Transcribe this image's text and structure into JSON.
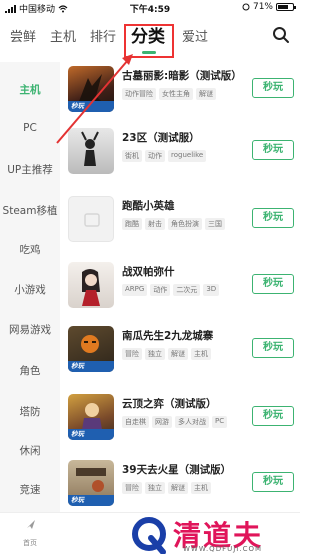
{
  "status_bar": {
    "carrier": "中国移动",
    "time": "下午4:59",
    "battery_text": "71%",
    "battery_level": 0.71
  },
  "top_tabs": [
    {
      "label": "尝鲜"
    },
    {
      "label": "主机"
    },
    {
      "label": "排行"
    },
    {
      "label": "分类"
    },
    {
      "label": "爱过"
    }
  ],
  "active_tab": "分类",
  "sidebar": {
    "items": [
      {
        "label": "主机"
      },
      {
        "label": "PC"
      },
      {
        "label": "UP主推荐"
      },
      {
        "label": "Steam移植"
      },
      {
        "label": "吃鸡"
      },
      {
        "label": "小游戏"
      },
      {
        "label": "网易游戏"
      },
      {
        "label": "角色"
      },
      {
        "label": "塔防"
      },
      {
        "label": "休闲"
      },
      {
        "label": "竞速"
      }
    ],
    "active": "主机"
  },
  "games": [
    {
      "title": "古墓丽影:暗影（测试版）",
      "tags": [
        "动作冒险",
        "女性主角",
        "解谜"
      ],
      "button": "秒玩",
      "badge": "秒玩"
    },
    {
      "title": "23区（测试服）",
      "tags": [
        "街机",
        "动作",
        "roguelike"
      ],
      "button": "秒玩",
      "badge": ""
    },
    {
      "title": "跑酷小英雄",
      "tags": [
        "跑酷",
        "射击",
        "角色扮演",
        "三国"
      ],
      "button": "秒玩",
      "badge": ""
    },
    {
      "title": "战双帕弥什",
      "tags": [
        "ARPG",
        "动作",
        "二次元",
        "3D"
      ],
      "button": "秒玩",
      "badge": ""
    },
    {
      "title": "南瓜先生2九龙城寨",
      "tags": [
        "冒险",
        "独立",
        "解谜",
        "主机"
      ],
      "button": "秒玩",
      "badge": "秒玩"
    },
    {
      "title": "云顶之弈（测试版）",
      "tags": [
        "自走棋",
        "网游",
        "多人对战",
        "PC"
      ],
      "button": "秒玩",
      "badge": "秒玩"
    },
    {
      "title": "39天去火星（测试版）",
      "tags": [
        "冒险",
        "独立",
        "解谜",
        "主机"
      ],
      "button": "秒玩",
      "badge": "秒玩"
    }
  ],
  "bottom_bar": {
    "home_label": "首页"
  },
  "watermark": {
    "text": "清道夫",
    "url": "WWW.QDFUJI.COM"
  },
  "colors": {
    "accent": "#3cb371",
    "annotation": "#e33333",
    "watermark": "#e0155a"
  }
}
